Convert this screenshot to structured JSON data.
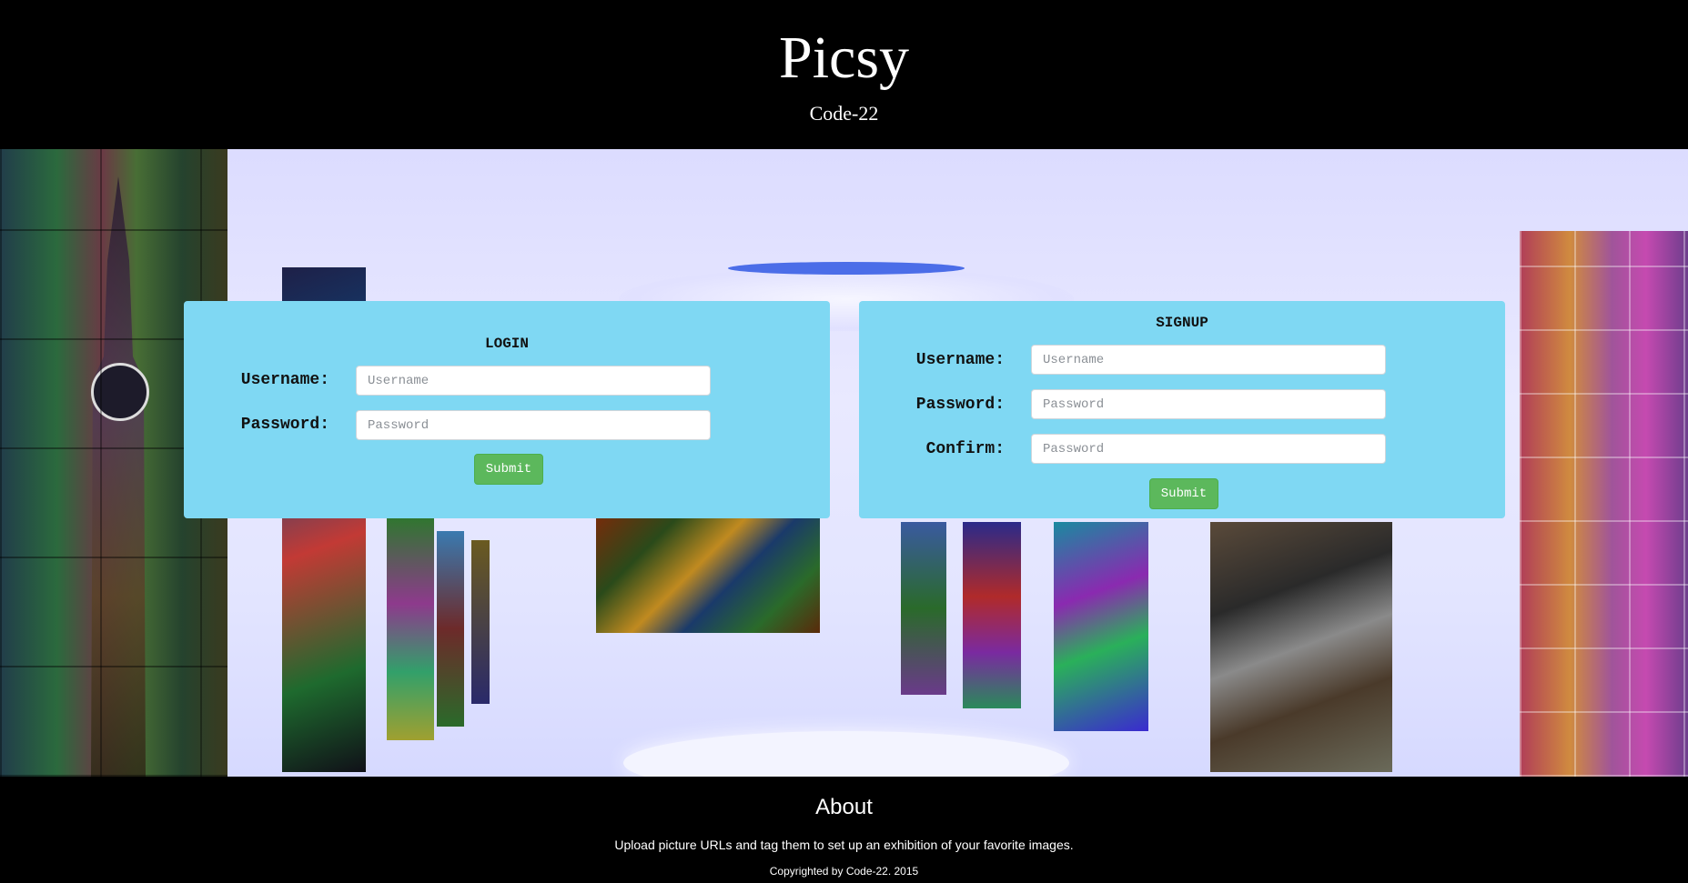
{
  "header": {
    "title": "Picsy",
    "subtitle": "Code-22"
  },
  "login": {
    "title": "LOGIN",
    "username_label": "Username:",
    "username_placeholder": "Username",
    "password_label": "Password:",
    "password_placeholder": "Password",
    "submit_label": "Submit"
  },
  "signup": {
    "title": "SIGNUP",
    "username_label": "Username:",
    "username_placeholder": "Username",
    "password_label": "Password:",
    "password_placeholder": "Password",
    "confirm_label": "Confirm:",
    "confirm_placeholder": "Password",
    "submit_label": "Submit"
  },
  "footer": {
    "about_title": "About",
    "about_text": "Upload picture URLs and tag them to set up an exhibition of your favorite images.",
    "copyright": "Copyrighted by Code-22. 2015"
  },
  "colors": {
    "panel": "#7fd8f3",
    "button": "#5cb85c",
    "background": "#000000"
  }
}
